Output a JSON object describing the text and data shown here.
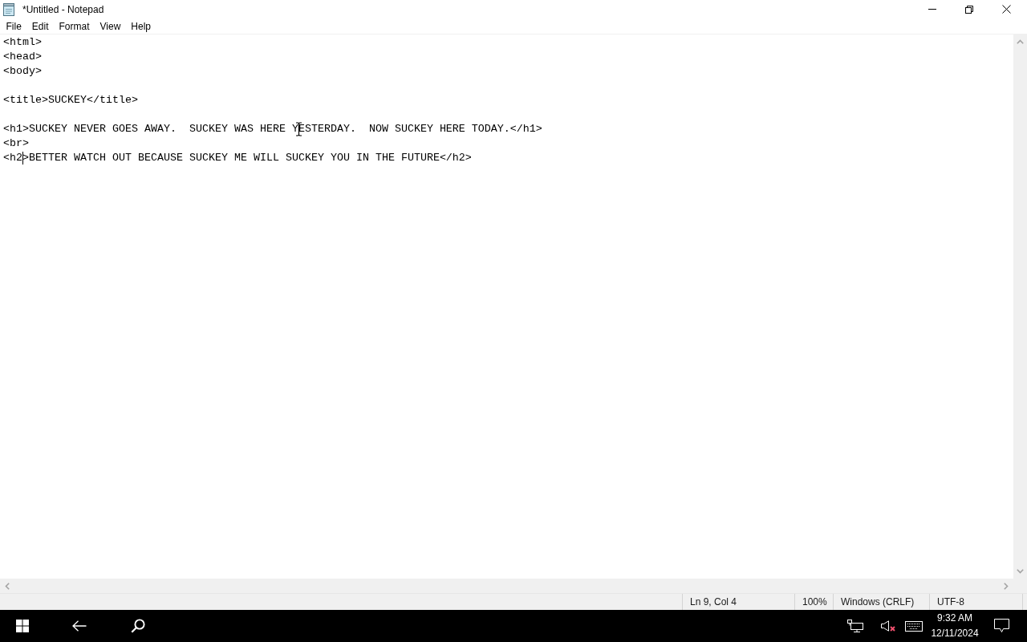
{
  "window": {
    "title": "*Untitled - Notepad"
  },
  "menu": [
    {
      "label": "File"
    },
    {
      "label": "Edit"
    },
    {
      "label": "Format"
    },
    {
      "label": "View"
    },
    {
      "label": "Help"
    }
  ],
  "editor": {
    "lines": [
      {
        "kind": "text",
        "text": "<html>",
        "caret": false
      },
      {
        "kind": "text",
        "text": "<head>",
        "caret": false
      },
      {
        "kind": "text",
        "text": "<body>",
        "caret": false
      },
      {
        "kind": "blank"
      },
      {
        "kind": "text",
        "text": "<title>SUCKEY</title>",
        "caret": false
      },
      {
        "kind": "blank"
      },
      {
        "kind": "text",
        "text": "<h1>SUCKEY NEVER GOES AWAY.  SUCKEY WAS HERE YESTERDAY.  NOW SUCKEY HERE TODAY.</h1>",
        "caret": false
      },
      {
        "kind": "text",
        "text": "<br>",
        "caret": false
      },
      {
        "kind": "text",
        "text": "<h2>BETTER WATCH OUT BECAUSE SUCKEY ME WILL SUCKEY YOU IN THE FUTURE</h2>",
        "caret": true
      }
    ]
  },
  "status_bar": {
    "position": "Ln 9, Col 4",
    "zoom": "100%",
    "line_ending": "Windows (CRLF)",
    "encoding": "UTF-8"
  },
  "taskbar": {
    "volume": {
      "muted": true
    },
    "clock": {
      "time": "9:32 AM",
      "date": "12/11/2024"
    }
  }
}
